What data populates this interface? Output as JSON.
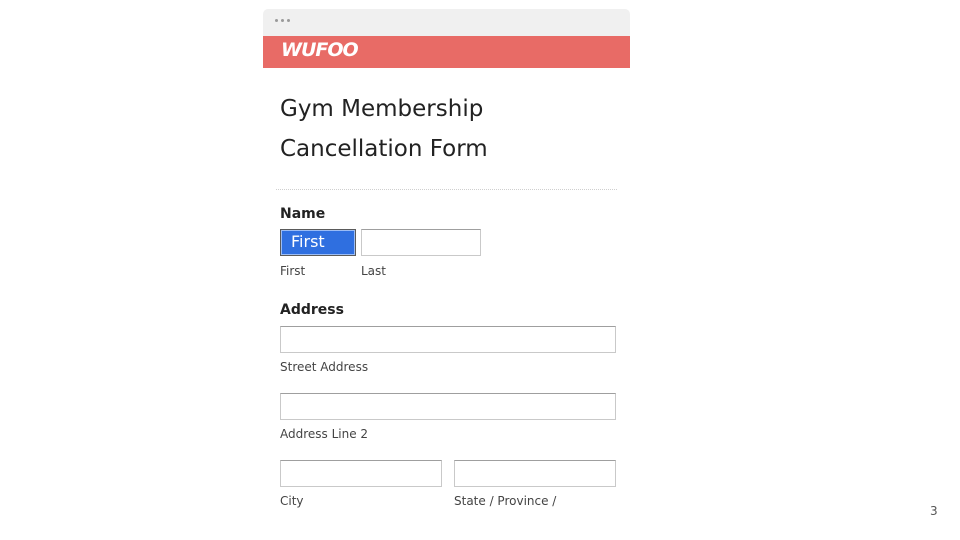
{
  "brand": {
    "logo_text": "WUFOO",
    "accent_color": "#e86b66"
  },
  "form": {
    "title": "Gym Membership Cancellation Form",
    "name_section": {
      "label": "Name",
      "first_value": "First",
      "first_sublabel": "First",
      "last_sublabel": "Last"
    },
    "address_section": {
      "label": "Address",
      "street_sublabel": "Street Address",
      "line2_sublabel": "Address Line 2",
      "city_sublabel": "City",
      "state_sublabel": "State / Province /"
    }
  },
  "slide": {
    "page_number": "3"
  }
}
